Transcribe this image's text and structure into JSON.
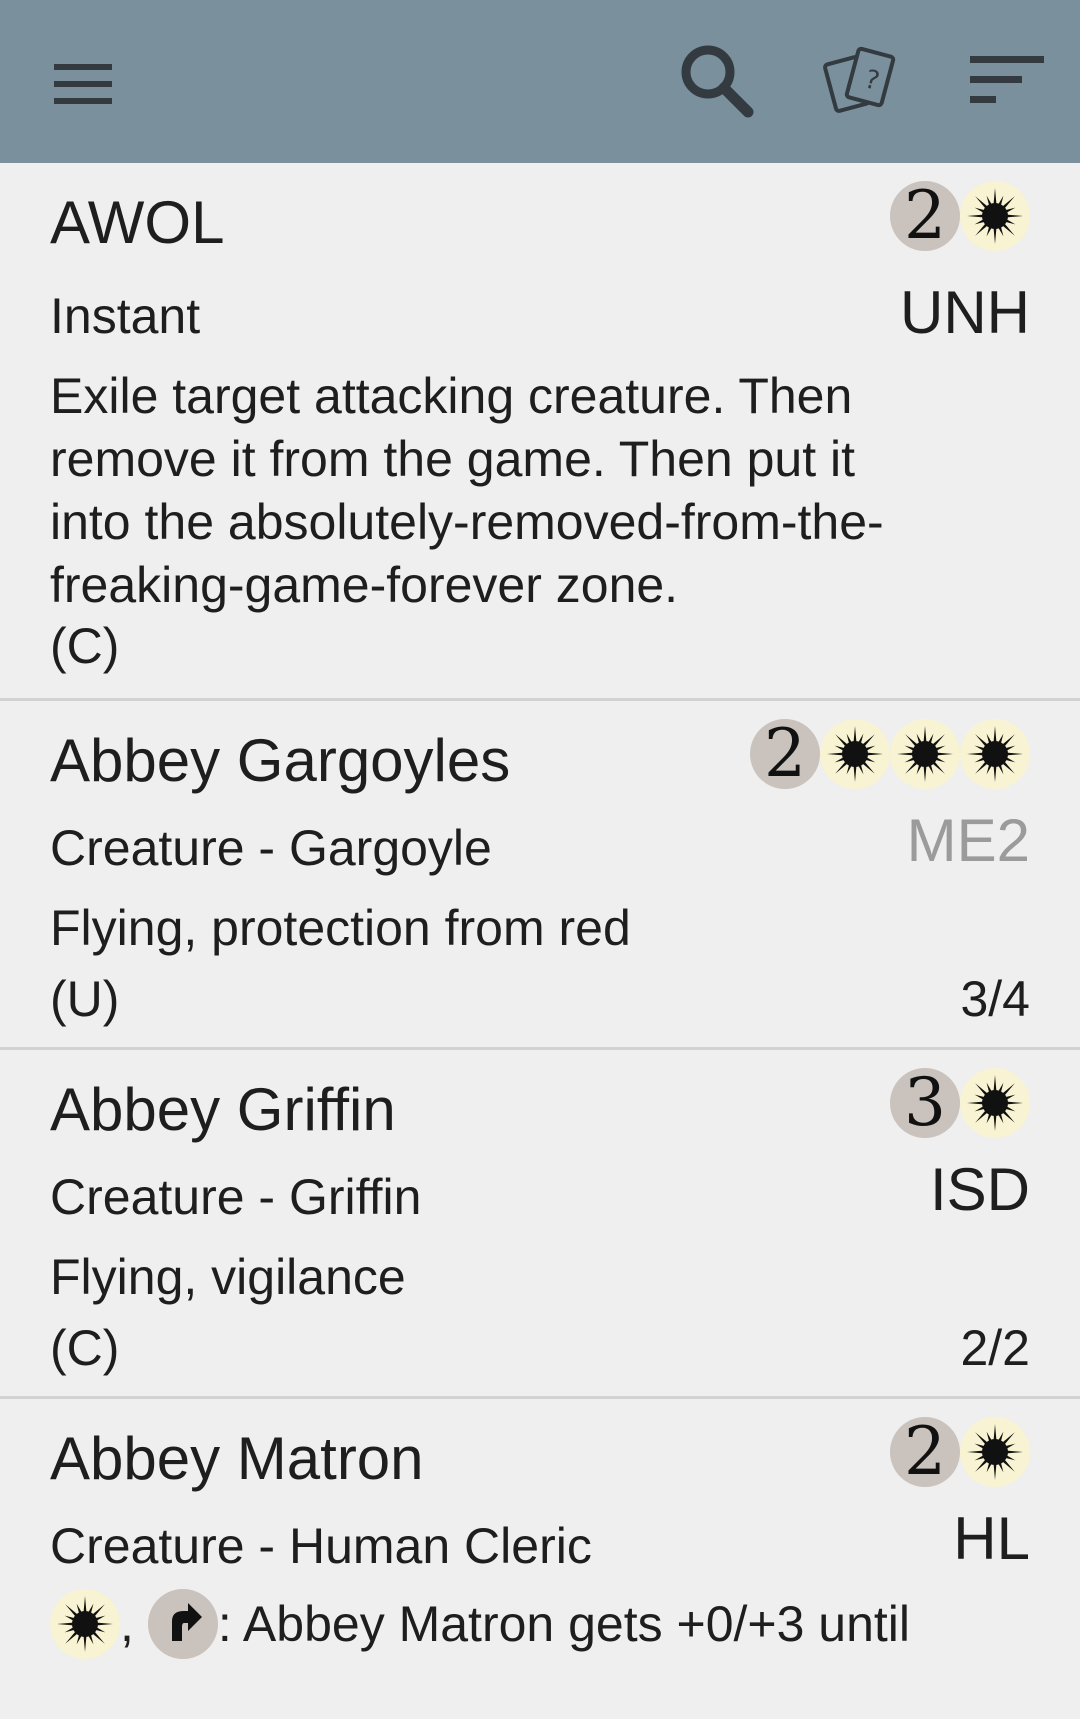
{
  "toolbar": {
    "menu_icon": "menu-icon",
    "search_icon": "search-icon",
    "random_card_icon": "random-card-icon",
    "sort_icon": "sort-icon",
    "background": "#7a909d"
  },
  "cards": [
    {
      "name": "AWOL",
      "cost": [
        "2",
        "W"
      ],
      "type": "Instant",
      "set": "UNH",
      "rules": [
        "Exile target attacking creature. Then",
        "remove it from the game. Then put it",
        "into the absolutely-removed-from-the-",
        "freaking-game-forever zone."
      ],
      "rarity": "(C)",
      "pt": ""
    },
    {
      "name": "Abbey Gargoyles",
      "cost": [
        "2",
        "W",
        "W",
        "W"
      ],
      "type": "Creature - Gargoyle",
      "set": "ME2",
      "rules": [
        "Flying, protection from red"
      ],
      "rarity": "(U)",
      "pt": "3/4"
    },
    {
      "name": "Abbey Griffin",
      "cost": [
        "3",
        "W"
      ],
      "type": "Creature - Griffin",
      "set": "ISD",
      "rules": [
        "Flying, vigilance"
      ],
      "rarity": "(C)",
      "pt": "2/2"
    },
    {
      "name": "Abbey Matron",
      "cost": [
        "2",
        "W"
      ],
      "type": "Creature - Human Cleric",
      "set": "HL",
      "rules_suffix": ": Abbey Matron gets +0/+3 until",
      "rules_sep": ","
    }
  ]
}
